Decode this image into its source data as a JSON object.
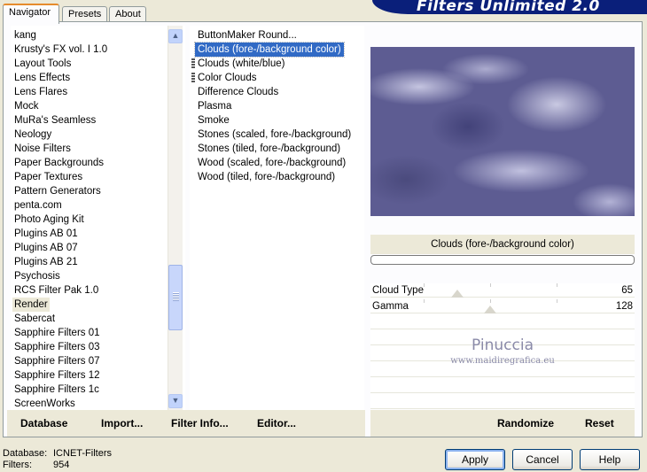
{
  "banner": {
    "title": "Filters Unlimited 2.0"
  },
  "tabs": [
    {
      "label": "Navigator",
      "active": true
    },
    {
      "label": "Presets",
      "active": false
    },
    {
      "label": "About",
      "active": false
    }
  ],
  "categories": {
    "items": [
      "kang",
      "Krusty's FX vol. I 1.0",
      "Layout Tools",
      "Lens Effects",
      "Lens Flares",
      "Mock",
      "MuRa's Seamless",
      "Neology",
      "Noise Filters",
      "Paper Backgrounds",
      "Paper Textures",
      "Pattern Generators",
      "penta.com",
      "Photo Aging Kit",
      "Plugins AB 01",
      "Plugins AB 07",
      "Plugins AB 21",
      "Psychosis",
      "RCS Filter Pak 1.0",
      "Render",
      "Sabercat",
      "Sapphire Filters 01",
      "Sapphire Filters 03",
      "Sapphire Filters 07",
      "Sapphire Filters 12",
      "Sapphire Filters 1c",
      "ScreenWorks"
    ],
    "selected": "Render"
  },
  "filters": {
    "items": [
      "ButtonMaker Round...",
      "Clouds (fore-/background color)",
      "Clouds (white/blue)",
      "Color Clouds",
      "Difference Clouds",
      "Plasma",
      "Smoke",
      "Stones (scaled, fore-/background)",
      "Stones (tiled, fore-/background)",
      "Wood (scaled, fore-/background)",
      "Wood (tiled, fore-/background)"
    ],
    "selected": "Clouds (fore-/background color)",
    "marked": [
      "Clouds (white/blue)",
      "Color Clouds"
    ]
  },
  "preview": {
    "filter_name": "Clouds (fore-/background color)",
    "colors": {
      "cloud_dark": "#5d5c92",
      "cloud_light": "#d8d8ee"
    }
  },
  "controls": [
    {
      "label": "Cloud Type",
      "value": "65",
      "level": 65
    },
    {
      "label": "Gamma",
      "value": "128",
      "level": 128
    }
  ],
  "watermark": {
    "line1": "Pinuccia",
    "line2": "www.maidiregrafica.eu"
  },
  "commands": {
    "database": "Database",
    "import": "Import...",
    "filter_info": "Filter Info...",
    "editor": "Editor...",
    "randomize": "Randomize",
    "reset": "Reset"
  },
  "footer": {
    "database_label": "Database:",
    "database_value": "ICNET-Filters",
    "filters_label": "Filters:",
    "filters_value": "954"
  },
  "buttons": {
    "apply": "Apply",
    "cancel": "Cancel",
    "help": "Help"
  }
}
